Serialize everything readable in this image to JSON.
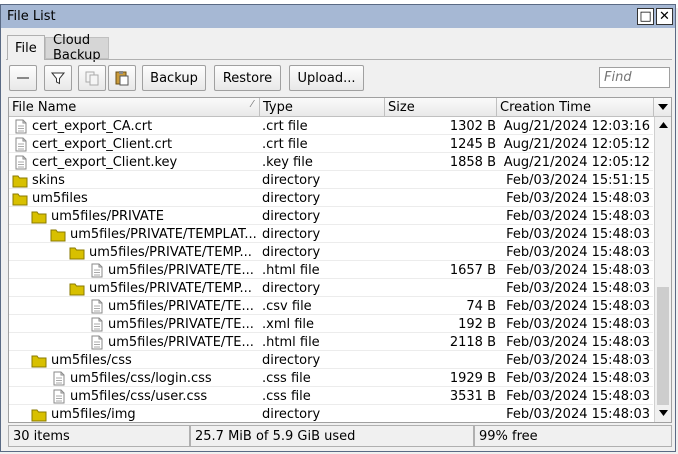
{
  "window": {
    "title": "File List"
  },
  "title_buttons": {
    "maximize": "□",
    "close": "✕"
  },
  "tabs": [
    {
      "label": "File",
      "active": true
    },
    {
      "label": "Cloud Backup",
      "active": false
    }
  ],
  "toolbar": {
    "remove_icon": "minus-icon",
    "filter_icon": "filter-icon",
    "copy_icon": "copy-icon",
    "paste_icon": "paste-icon",
    "backup_label": "Backup",
    "restore_label": "Restore",
    "upload_label": "Upload...",
    "find_placeholder": "Find"
  },
  "columns": [
    {
      "label": "File Name"
    },
    {
      "label": "Type"
    },
    {
      "label": "Size"
    },
    {
      "label": "Creation Time"
    }
  ],
  "sort_indicator": "⁄",
  "files": [
    {
      "name": "cert_export_CA.crt",
      "type": ".crt file",
      "size": "1302 B",
      "time": "Aug/21/2024 12:03:16",
      "icon": "file-icon",
      "depth": 0
    },
    {
      "name": "cert_export_Client.crt",
      "type": ".crt file",
      "size": "1245 B",
      "time": "Aug/21/2024 12:05:12",
      "icon": "file-icon",
      "depth": 0
    },
    {
      "name": "cert_export_Client.key",
      "type": ".key file",
      "size": "1858 B",
      "time": "Aug/21/2024 12:05:12",
      "icon": "file-icon",
      "depth": 0
    },
    {
      "name": "skins",
      "type": "directory",
      "size": "",
      "time": "Feb/03/2024 15:51:15",
      "icon": "folder-icon",
      "depth": 0
    },
    {
      "name": "um5files",
      "type": "directory",
      "size": "",
      "time": "Feb/03/2024 15:48:03",
      "icon": "folder-icon",
      "depth": 0
    },
    {
      "name": "um5files/PRIVATE",
      "type": "directory",
      "size": "",
      "time": "Feb/03/2024 15:48:03",
      "icon": "folder-icon",
      "depth": 1
    },
    {
      "name": "um5files/PRIVATE/TEMPLAT...",
      "type": "directory",
      "size": "",
      "time": "Feb/03/2024 15:48:03",
      "icon": "folder-icon",
      "depth": 2
    },
    {
      "name": "um5files/PRIVATE/TEMP...",
      "type": "directory",
      "size": "",
      "time": "Feb/03/2024 15:48:03",
      "icon": "folder-icon",
      "depth": 3
    },
    {
      "name": "um5files/PRIVATE/TE...",
      "type": ".html file",
      "size": "1657 B",
      "time": "Feb/03/2024 15:48:03",
      "icon": "file-icon",
      "depth": 4
    },
    {
      "name": "um5files/PRIVATE/TEMP...",
      "type": "directory",
      "size": "",
      "time": "Feb/03/2024 15:48:03",
      "icon": "folder-icon",
      "depth": 3
    },
    {
      "name": "um5files/PRIVATE/TE...",
      "type": ".csv file",
      "size": "74 B",
      "time": "Feb/03/2024 15:48:03",
      "icon": "file-icon",
      "depth": 4
    },
    {
      "name": "um5files/PRIVATE/TE...",
      "type": ".xml file",
      "size": "192 B",
      "time": "Feb/03/2024 15:48:03",
      "icon": "file-icon",
      "depth": 4
    },
    {
      "name": "um5files/PRIVATE/TE...",
      "type": ".html file",
      "size": "2118 B",
      "time": "Feb/03/2024 15:48:03",
      "icon": "file-icon",
      "depth": 4
    },
    {
      "name": "um5files/css",
      "type": "directory",
      "size": "",
      "time": "Feb/03/2024 15:48:03",
      "icon": "folder-icon",
      "depth": 1
    },
    {
      "name": "um5files/css/login.css",
      "type": ".css file",
      "size": "1929 B",
      "time": "Feb/03/2024 15:48:03",
      "icon": "file-icon",
      "depth": 2
    },
    {
      "name": "um5files/css/user.css",
      "type": ".css file",
      "size": "3531 B",
      "time": "Feb/03/2024 15:48:03",
      "icon": "file-icon",
      "depth": 2
    },
    {
      "name": "um5files/img",
      "type": "directory",
      "size": "",
      "time": "Feb/03/2024 15:48:03",
      "icon": "folder-icon",
      "depth": 1
    }
  ],
  "status": {
    "items": "30 items",
    "used": "25.7 MiB of 5.9 GiB used",
    "free": "99% free"
  },
  "colors": {
    "titlebar": "#a6b8d4",
    "folder": "#d8c000"
  }
}
